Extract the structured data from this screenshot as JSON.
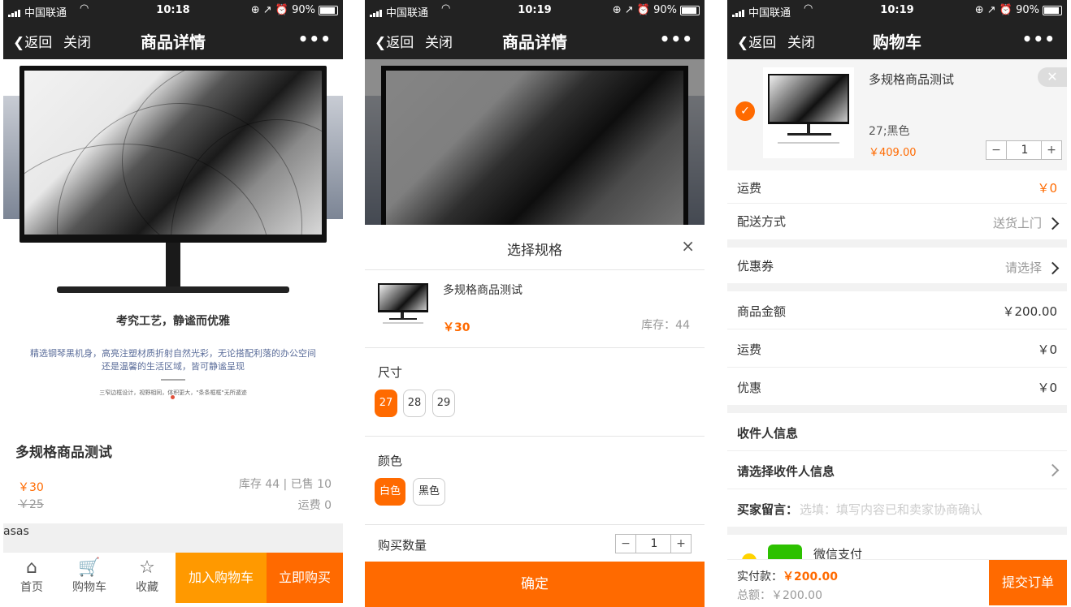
{
  "status": {
    "carrier": "中国联通",
    "time": "10:18",
    "time2": "10:19",
    "time3": "10:19",
    "battery": "90%",
    "icons": "⊕ ↗ ⏰"
  },
  "p1": {
    "nav": {
      "back": "返回",
      "close": "关闭",
      "title": "商品详情",
      "more": "•••"
    },
    "banner": {
      "slogan": "考究工艺，静谧而优雅",
      "desc1": "精选钢琴黑机身，高亮注塑材质折射自然光彩，无论搭配利落的办公空间",
      "desc2": "还是温馨的生活区域，皆可静谧呈现",
      "small": "三窄边框设计，视野相同，体积更大，\"条条框框\"无所遁迹"
    },
    "product_name": "多规格商品测试",
    "price": "￥30",
    "original_price": "￥25",
    "stock_sold": "库存 44 | 已售 10",
    "shipping": "运费 0",
    "note": "asas",
    "tabs": [
      {
        "icon": "home-icon",
        "glyph": "⌂",
        "label": "首页"
      },
      {
        "icon": "cart-icon",
        "glyph": "🛒",
        "label": "购物车"
      },
      {
        "icon": "star-icon",
        "glyph": "☆",
        "label": "收藏"
      }
    ],
    "add_cart": "加入购物车",
    "buy_now": "立即购买"
  },
  "p2": {
    "nav": {
      "back": "返回",
      "close": "关闭",
      "title": "商品详情",
      "more": "•••"
    },
    "sheet_title": "选择规格",
    "close_glyph": "×",
    "product_name": "多规格商品测试",
    "price": "￥30",
    "stock": "库存：44",
    "size_label": "尺寸",
    "sizes": [
      "27",
      "28",
      "29"
    ],
    "color_label": "颜色",
    "colors": [
      "白色",
      "黑色"
    ],
    "qty_label": "购买数量",
    "qty": "1",
    "confirm": "确定"
  },
  "p3": {
    "nav": {
      "back": "返回",
      "close": "关闭",
      "title": "购物车",
      "more": "•••"
    },
    "item": {
      "name": "多规格商品测试",
      "spec": "27;黑色",
      "price": "￥409.00",
      "qty": "1"
    },
    "freight": {
      "label": "运费",
      "value": "￥0"
    },
    "delivery": {
      "label": "配送方式",
      "value": "送货上门"
    },
    "coupon": {
      "label": "优惠券",
      "value": "请选择"
    },
    "goods_amount": {
      "label": "商品金额",
      "value": "￥200.00"
    },
    "freight2": {
      "label": "运费",
      "value": "￥0"
    },
    "discount": {
      "label": "优惠",
      "value": "￥0"
    },
    "receiver_title": "收件人信息",
    "receiver_select": "请选择收件人信息",
    "message_label": "买家留言：",
    "message_placeholder": "选填：填写内容已和卖家协商确认",
    "pay_method": "微信支付",
    "paid_label": "实付款：",
    "paid_value": "￥200.00",
    "total_label": "总额：",
    "total_value": "￥200.00",
    "submit": "提交订单"
  }
}
